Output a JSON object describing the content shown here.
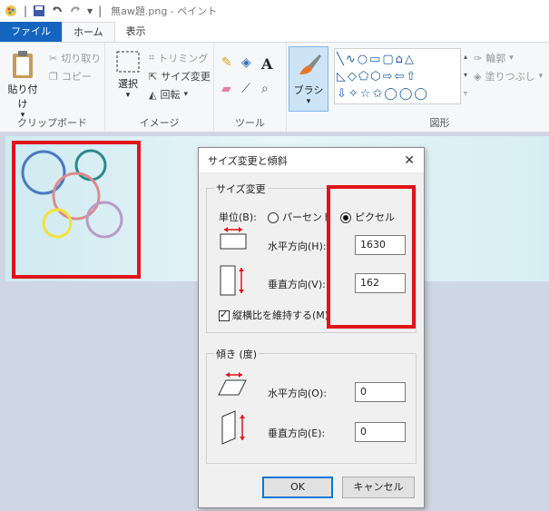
{
  "window": {
    "title": "無aw題.png - ペイント"
  },
  "tabs": [
    {
      "label": "ファイル"
    },
    {
      "label": "ホーム"
    },
    {
      "label": "表示"
    }
  ],
  "clipboard": {
    "paste": "貼り付け",
    "cut": "切り取り",
    "copy": "コピー",
    "group": "クリップボード"
  },
  "image": {
    "select": "選択",
    "crop": "トリミング",
    "resize": "サイズ変更",
    "rotate": "回転",
    "group": "イメージ"
  },
  "tools": {
    "group": "ツール"
  },
  "brush": {
    "label": "ブラシ"
  },
  "shapes": {
    "outline": "輪郭",
    "fill": "塗りつぶし",
    "group": "図形"
  },
  "dialog": {
    "title": "サイズ変更と傾斜",
    "resize_legend": "サイズ変更",
    "unit_label": "単位(B):",
    "percent": "パーセント",
    "pixel": "ピクセル",
    "horizontal_label": "水平方向(H):",
    "horizontal_value": "1630",
    "vertical_label": "垂直方向(V):",
    "vertical_value": "162",
    "keep_aspect": "縦横比を維持する(M)",
    "skew_legend": "傾き (度)",
    "skew_h_label": "水平方向(O):",
    "skew_h_value": "0",
    "skew_v_label": "垂直方向(E):",
    "skew_v_value": "0",
    "ok": "OK",
    "cancel": "キャンセル"
  },
  "colors": {
    "accent": "#1565c0",
    "highlight": "#e0141b"
  }
}
